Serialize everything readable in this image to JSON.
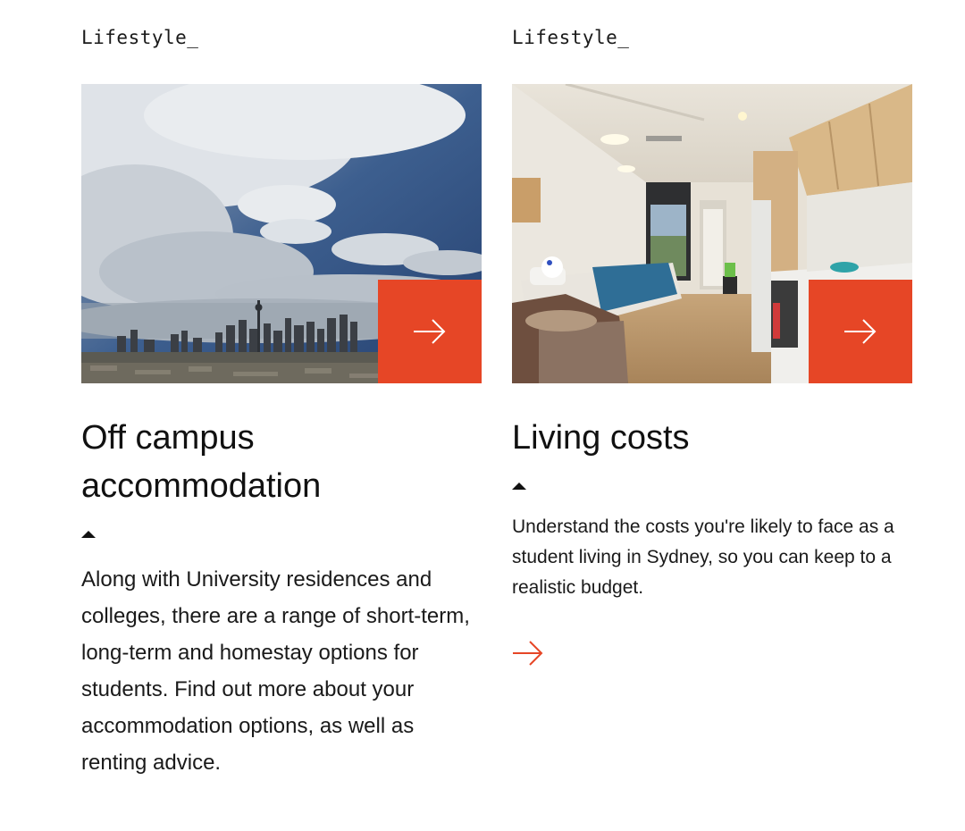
{
  "cards": [
    {
      "kicker": "Lifestyle_",
      "title": "Off campus accommodation",
      "description": "Along with University residences and colleges, there are a range of short-term, long-term and homestay options for students. Find out more about your accommodation options, as well as renting advice.",
      "image_icon": "sydney-skyline-photo",
      "link_icon": "arrow-right-icon"
    },
    {
      "kicker": "Lifestyle_",
      "title": "Living costs",
      "description": "Understand the costs you're likely to face as a student living in Sydney, so you can keep to a realistic budget.",
      "image_icon": "student-studio-room-photo",
      "link_icon": "arrow-right-icon"
    }
  ],
  "colors": {
    "accent": "#e64626",
    "text": "#1a1a1a",
    "background": "#ffffff"
  }
}
